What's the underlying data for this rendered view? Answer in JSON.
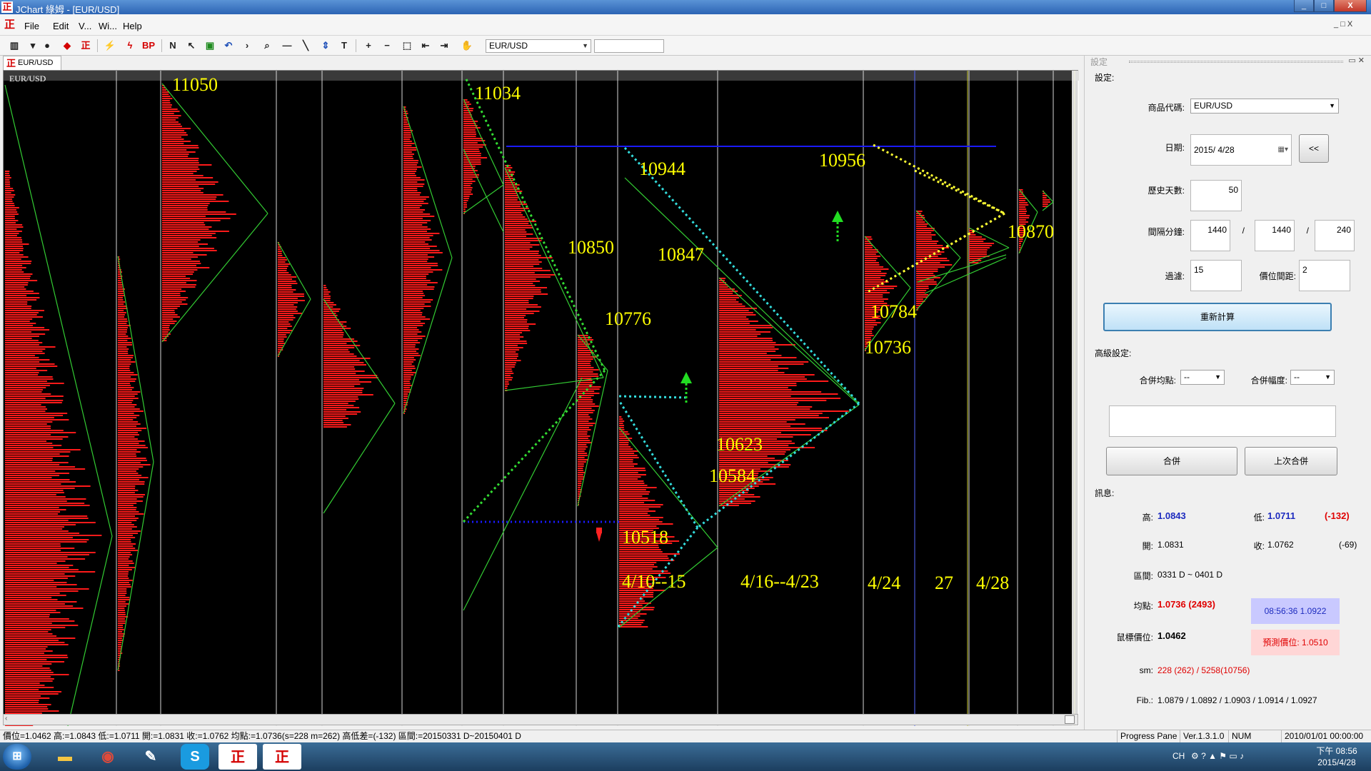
{
  "window": {
    "title": "JChart 綠姆 - [EUR/USD]",
    "min": "_",
    "max": "□",
    "close": "X"
  },
  "menu": {
    "file": "File",
    "edit": "Edit",
    "view": "V...",
    "window": "Wi...",
    "help": "Help",
    "mdi_controls": "_ □ X"
  },
  "toolbar": {
    "symbol_select": "EUR/USD",
    "symbol_input": "",
    "bp_label": "BP",
    "text_tool_label": "T"
  },
  "doc_tab": {
    "label": "EUR/USD"
  },
  "chart": {
    "symbol": "EUR/USD",
    "labels": [
      {
        "text": "11050"
      },
      {
        "text": "11034"
      },
      {
        "text": "10944"
      },
      {
        "text": "10956"
      },
      {
        "text": "10870"
      },
      {
        "text": "10850"
      },
      {
        "text": "10847"
      },
      {
        "text": "10784"
      },
      {
        "text": "10776"
      },
      {
        "text": "10736"
      },
      {
        "text": "10623"
      },
      {
        "text": "10584"
      },
      {
        "text": "10518"
      }
    ],
    "date_labels": [
      {
        "text": "4/10--15"
      },
      {
        "text": "4/16--4/23"
      },
      {
        "text": "4/24"
      },
      {
        "text": "27"
      },
      {
        "text": "4/28"
      }
    ],
    "colors": {
      "background": "#000000",
      "profile": "#ff1a1a",
      "line": "#33cc33",
      "label": "#ffff00",
      "blue_line": "#1a1aff",
      "cyan_dots": "#33dddd",
      "yellow_dots": "#ffff33",
      "green_arrow": "#22dd22",
      "red_arrow": "#ff2222"
    }
  },
  "pane": {
    "title": "設定",
    "section_settings": "設定:",
    "symbol_label": "商品代碼:",
    "symbol_value": "EUR/USD",
    "date_label": "日期:",
    "date_value": "2015/ 4/28",
    "back_button": "<<",
    "history_days_label": "歷史天數:",
    "history_days_value": "50",
    "interval_label": "間隔分鐘:",
    "interval_values": [
      "1440",
      "1440",
      "240",
      ""
    ],
    "interval_sep": "/",
    "filter_label": "過濾:",
    "filter_value": "15",
    "price_interval_label": "價位間距:",
    "price_interval_value": "2",
    "recalc_button": "重新計算",
    "section_advanced": "高級設定:",
    "merge_avg_label": "合併均點:",
    "merge_avg_value": "--",
    "merge_range_label": "合併幅度:",
    "merge_range_value": "--",
    "merge_button": "合併",
    "last_merge_button": "上次合併",
    "section_info": "訊息:",
    "info": {
      "high_label": "高:",
      "high_value": "1.0843",
      "low_label": "低:",
      "low_value": "1.0711",
      "low_diff": "(-132)",
      "open_label": "開:",
      "open_value": "1.0831",
      "close_label": "收:",
      "close_value": "1.0762",
      "close_diff": "(-69)",
      "range_label": "區間:",
      "range_value": "0331 D ~ 0401 D",
      "avg_label": "均點:",
      "avg_value": "1.0736 (2493)",
      "time_box": "08:56:36  1.0922",
      "cursor_label": "鼠標價位:",
      "cursor_value": "1.0462",
      "pred_box": "預測價位: 1.0510",
      "sm_label": "sm:",
      "sm_value": "228 (262) / 5258(10756)",
      "fib_label": "Fib.:",
      "fib_value": "1.0879 / 1.0892 / 1.0903 / 1.0914 / 1.0927"
    }
  },
  "status": {
    "text": "價位=1.0462  高:=1.0843  低:=1.0711  開:=1.0831  收:=1.0762  均點:=1.0736(s=228 m=262)  高低差=(-132)  區間:=20150331 D~20150401 D",
    "progress": "Progress Pane",
    "version": "Ver.1.3.1.0",
    "num": "NUM",
    "datetime": "2010/01/01 00:00:00"
  },
  "taskbar": {
    "lang": "CH",
    "time": "下午 08:56",
    "date": "2015/4/28"
  }
}
